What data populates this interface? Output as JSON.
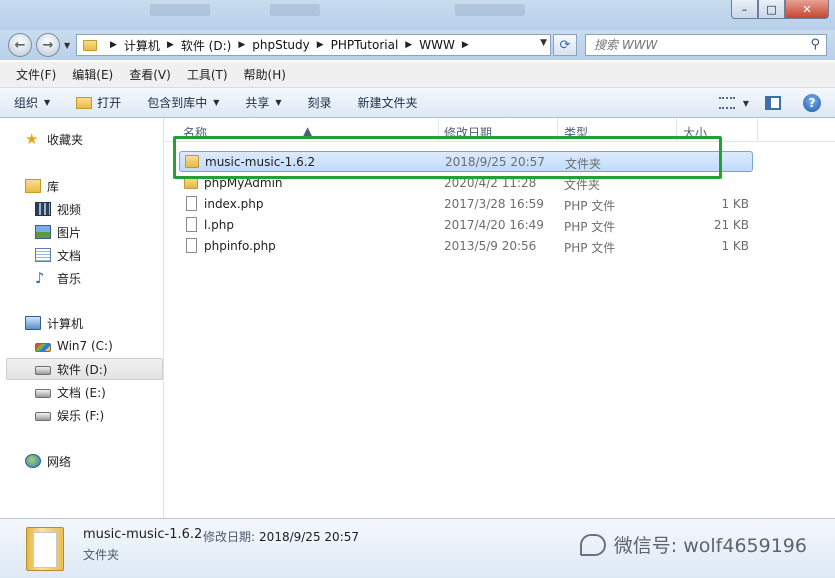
{
  "window": {
    "minimize": "–",
    "maximize": "□",
    "close": "✕"
  },
  "address": {
    "crumbs": [
      "计算机",
      "软件 (D:)",
      "phpStudy",
      "PHPTutorial",
      "WWW"
    ],
    "search_placeholder": "搜索 WWW"
  },
  "menu": [
    "文件(F)",
    "编辑(E)",
    "查看(V)",
    "工具(T)",
    "帮助(H)"
  ],
  "commands": {
    "organize": "组织",
    "open": "打开",
    "include": "包含到库中",
    "share": "共享",
    "burn": "刻录",
    "new_folder": "新建文件夹"
  },
  "sidebar": {
    "favorites": "收藏夹",
    "libraries": "库",
    "lib_items": [
      "视频",
      "图片",
      "文档",
      "音乐"
    ],
    "computer": "计算机",
    "drives": [
      "Win7 (C:)",
      "软件 (D:)",
      "文档 (E:)",
      "娱乐 (F:)"
    ],
    "network": "网络"
  },
  "columns": {
    "name": "名称",
    "date": "修改日期",
    "type": "类型",
    "size": "大小"
  },
  "files": [
    {
      "name": "music-music-1.6.2",
      "date": "2018/9/25 20:57",
      "type": "文件夹",
      "size": ""
    },
    {
      "name": "phpMyAdmin",
      "date": "2020/4/2 11:28",
      "type": "文件夹",
      "size": ""
    },
    {
      "name": "index.php",
      "date": "2017/3/28 16:59",
      "type": "PHP 文件",
      "size": "1 KB"
    },
    {
      "name": "l.php",
      "date": "2017/4/20 16:49",
      "type": "PHP 文件",
      "size": "21 KB"
    },
    {
      "name": "phpinfo.php",
      "date": "2013/5/9 20:56",
      "type": "PHP 文件",
      "size": "1 KB"
    }
  ],
  "details": {
    "name": "music-music-1.6.2",
    "modified_label": "修改日期:",
    "modified_value": "2018/9/25 20:57",
    "type": "文件夹"
  },
  "watermark": "微信号: wolf4659196",
  "colors": {
    "highlight": "#22a13b",
    "selection": "#c1dbfc"
  }
}
